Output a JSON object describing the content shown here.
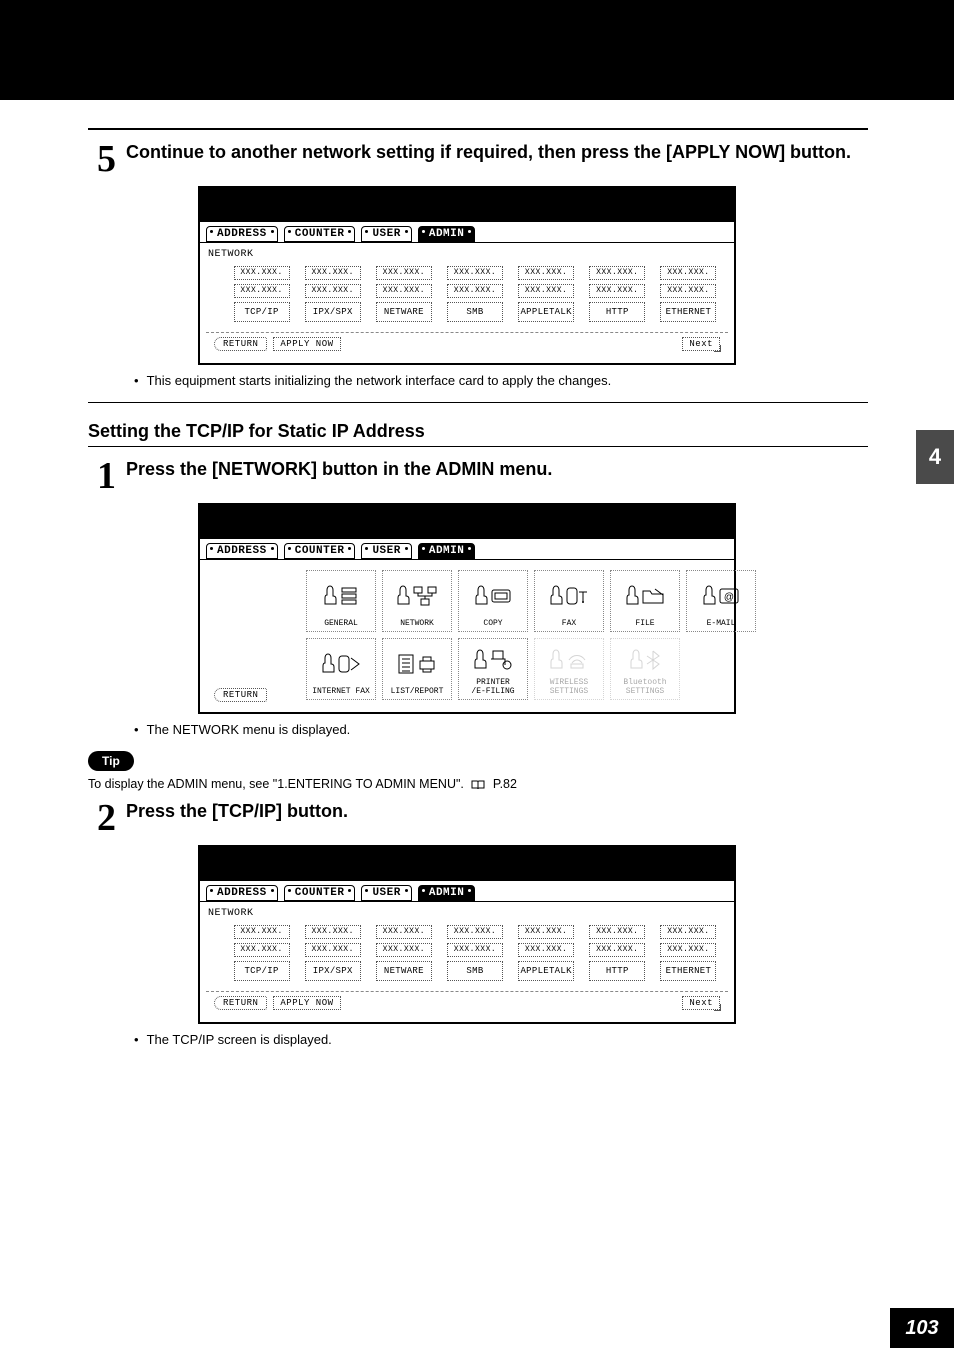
{
  "sideTab": "4",
  "pageNumber": "103",
  "step5": {
    "num": "5",
    "text": "Continue to another network setting if required, then press the [APPLY NOW] button.",
    "note": "This equipment starts initializing the network interface card to apply the changes."
  },
  "section": {
    "heading": "Setting the TCP/IP for Static IP Address"
  },
  "step1": {
    "num": "1",
    "text": "Press the [NETWORK] button in the ADMIN menu.",
    "note": "The NETWORK menu is displayed.",
    "tipLabel": "Tip",
    "tipText": "To display the ADMIN menu, see \"1.ENTERING TO ADMIN MENU\".",
    "tipPage": "P.82"
  },
  "step2": {
    "num": "2",
    "text": "Press the [TCP/IP] button.",
    "note": "The TCP/IP screen is displayed."
  },
  "tabs": {
    "address": "ADDRESS",
    "counter": "COUNTER",
    "user": "USER",
    "admin": "ADMIN"
  },
  "netshot": {
    "subtitle": "NETWORK",
    "placeholder": "XXX.XXX.",
    "cols": [
      "TCP/IP",
      "IPX/SPX",
      "NETWARE",
      "SMB",
      "APPLETALK",
      "HTTP",
      "ETHERNET"
    ],
    "return": "RETURN",
    "apply": "APPLY NOW",
    "next": "Next"
  },
  "adminshot": {
    "row1": [
      "GENERAL",
      "NETWORK",
      "COPY",
      "FAX",
      "FILE",
      "E-MAIL"
    ],
    "row2": [
      "INTERNET FAX",
      "LIST/REPORT",
      "PRINTER\n/E-FILING",
      "WIRELESS\nSETTINGS",
      "Bluetooth\nSETTINGS"
    ],
    "return": "RETURN"
  }
}
